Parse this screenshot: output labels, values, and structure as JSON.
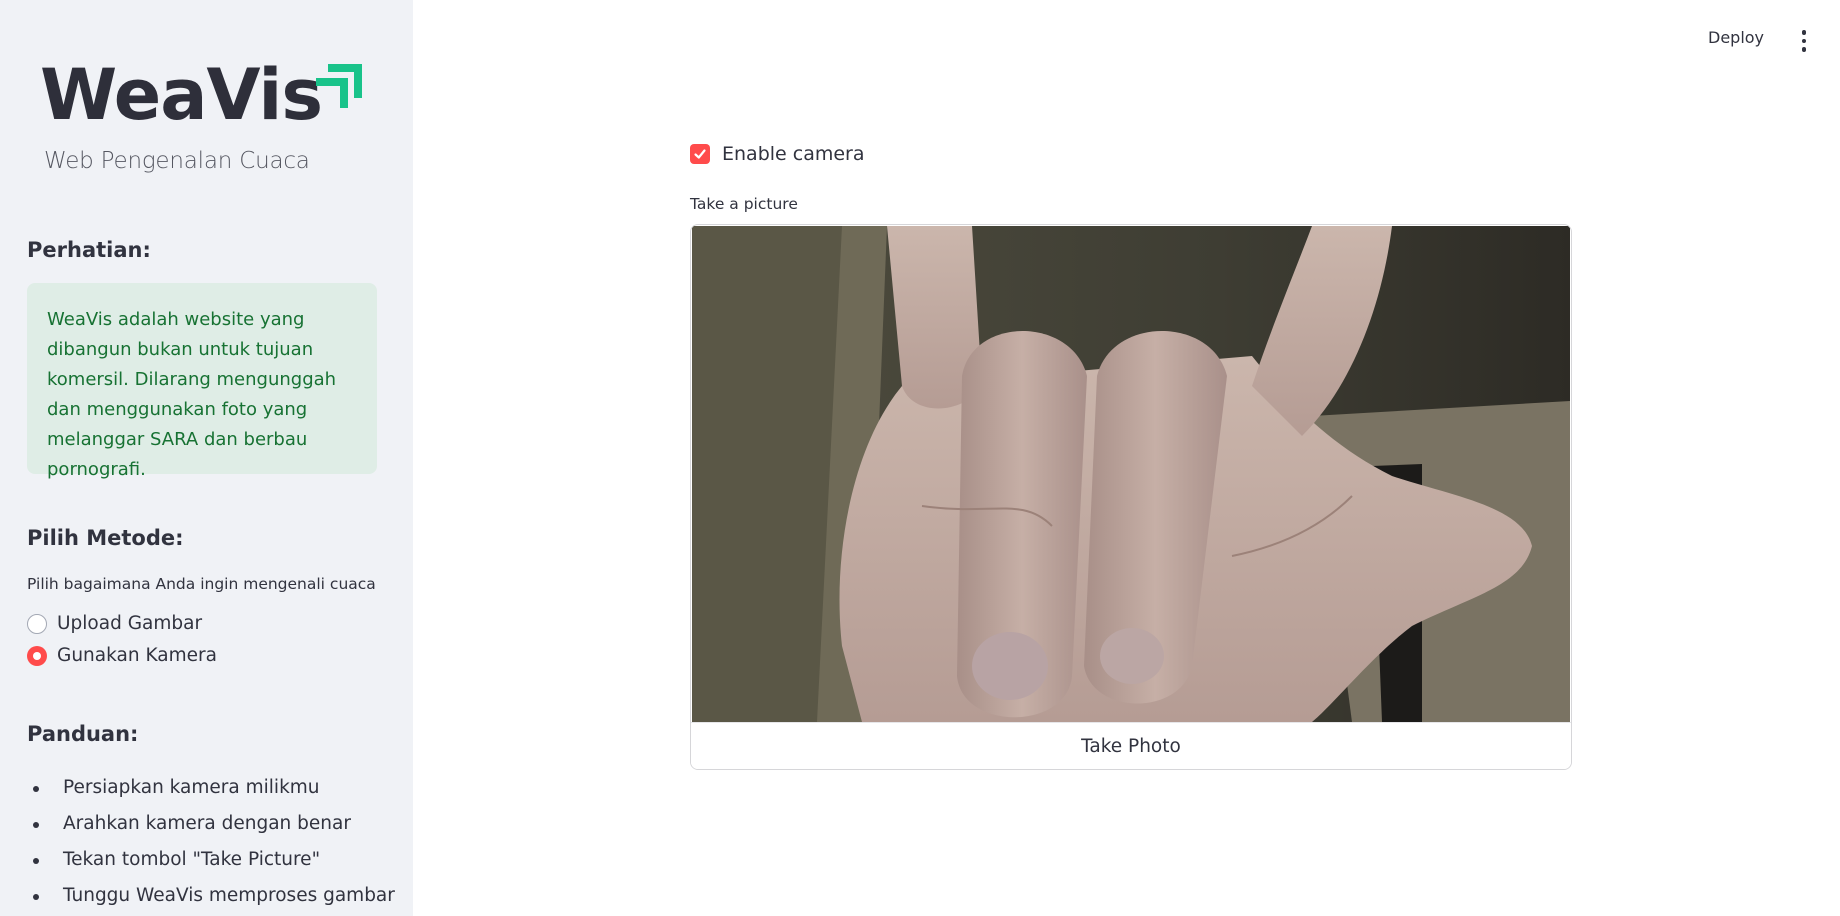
{
  "app": {
    "logo_text": "WeaVis",
    "tagline": "Web Pengenalan Cuaca",
    "brand_accent": "#19c38a"
  },
  "header": {
    "deploy_label": "Deploy",
    "menu_icon": "kebab-vertical-icon"
  },
  "sidebar": {
    "notice_title": "Perhatian:",
    "notice_text": "WeaVis adalah website yang dibangun bukan untuk tujuan komersil. Dilarang mengunggah dan menggunakan foto yang melanggar SARA dan berbau pornografi.",
    "method_title": "Pilih Metode:",
    "method_caption": "Pilih bagaimana Anda ingin mengenali cuaca",
    "methods": [
      {
        "label": "Upload Gambar",
        "selected": false
      },
      {
        "label": "Gunakan Kamera",
        "selected": true
      }
    ],
    "guide_title": "Panduan:",
    "guide_items": [
      "Persiapkan kamera milikmu",
      "Arahkan kamera dengan benar",
      "Tekan tombol \"Take Picture\"",
      "Tunggu WeaVis memproses gambar"
    ]
  },
  "main": {
    "enable_camera_label": "Enable camera",
    "enable_camera_checked": true,
    "camera_label": "Take a picture",
    "take_photo_label": "Take Photo"
  },
  "colors": {
    "primary": "#ff4b4b",
    "sidebar_bg": "#f0f2f6",
    "notice_bg": "#dfede6",
    "notice_text": "#177233"
  }
}
